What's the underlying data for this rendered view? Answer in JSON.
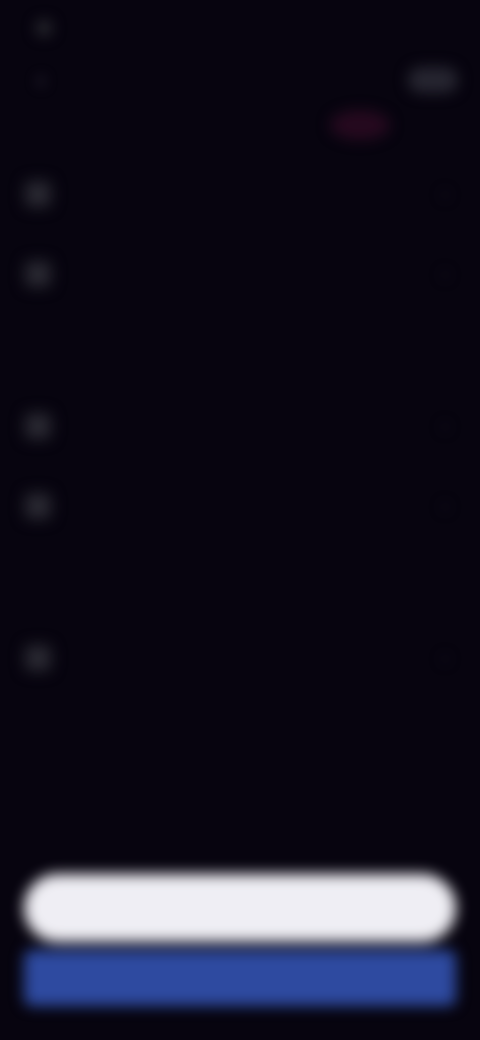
{
  "status_bar": {
    "time": ""
  },
  "header": {
    "brand_part1": "",
    "brand_part2": ""
  },
  "sections": [
    {
      "label": "",
      "items": [
        {
          "label": "",
          "icon": "settings-icon"
        },
        {
          "label": "",
          "icon": "settings-icon"
        }
      ]
    },
    {
      "label": "",
      "items": [
        {
          "label": "",
          "icon": "settings-icon"
        },
        {
          "label": "",
          "icon": "settings-icon"
        }
      ]
    },
    {
      "label": "",
      "items": [
        {
          "label": "",
          "icon": "settings-icon"
        }
      ]
    }
  ],
  "footer": {
    "title": "",
    "subtitle": "",
    "primary_button": "",
    "secondary_button": ""
  },
  "colors": {
    "background": "#07040f",
    "brand_accent": "#6b4aa8",
    "primary_button": "#efeef4",
    "secondary_button": "#2e4aa0"
  }
}
